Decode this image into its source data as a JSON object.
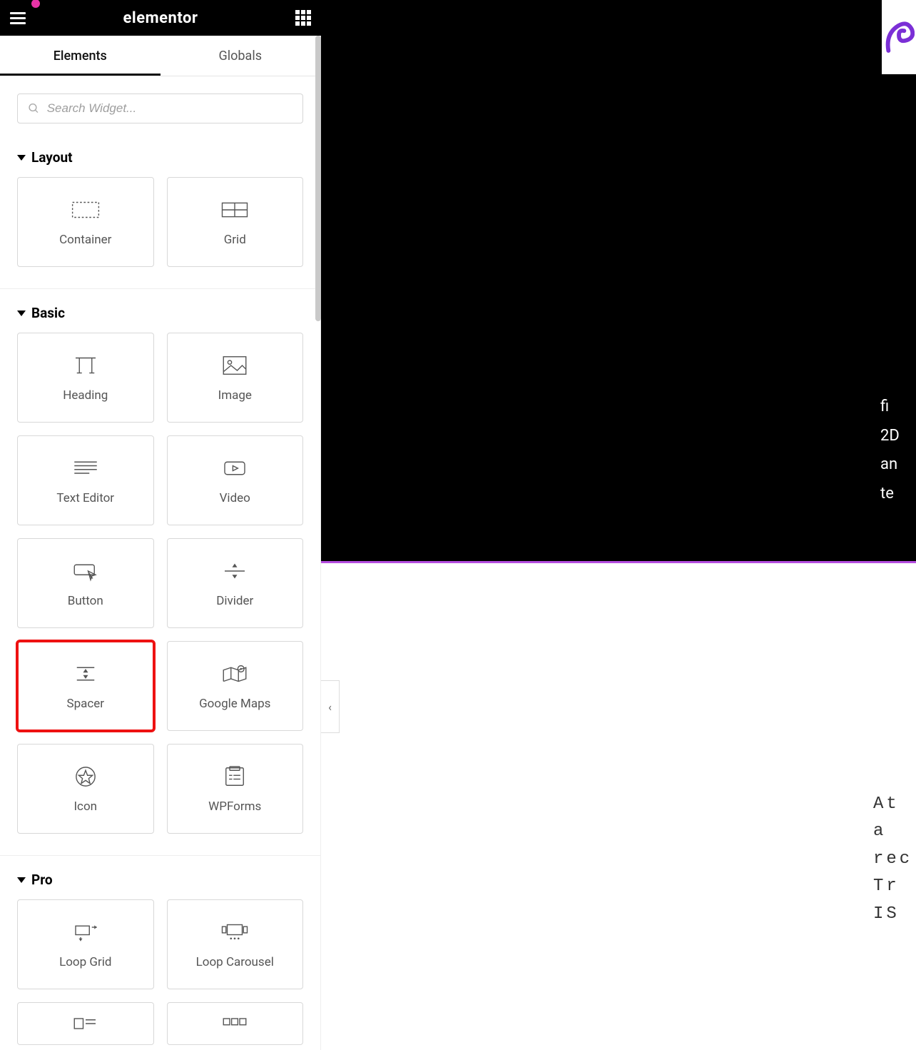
{
  "header": {
    "brand": "elementor"
  },
  "tabs": {
    "elements": "Elements",
    "globals": "Globals"
  },
  "search": {
    "placeholder": "Search Widget..."
  },
  "sections": {
    "layout": {
      "title": "Layout",
      "widgets": {
        "container": "Container",
        "grid": "Grid"
      }
    },
    "basic": {
      "title": "Basic",
      "widgets": {
        "heading": "Heading",
        "image": "Image",
        "text_editor": "Text Editor",
        "video": "Video",
        "button": "Button",
        "divider": "Divider",
        "spacer": "Spacer",
        "google_maps": "Google Maps",
        "icon": "Icon",
        "wpforms": "WPForms"
      }
    },
    "pro": {
      "title": "Pro",
      "widgets": {
        "loop_grid": "Loop Grid",
        "loop_carousel": "Loop Carousel"
      }
    }
  },
  "canvas": {
    "collapse_glyph": "‹",
    "top_text": "fi\n2D\nan\nte",
    "serif_text": "At\na\nrec\nTr\nIS"
  }
}
